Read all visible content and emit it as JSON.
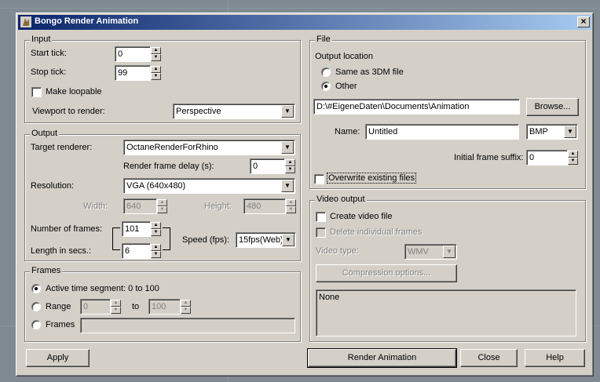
{
  "window": {
    "title": "Bongo Render Animation",
    "close_glyph": "×"
  },
  "input": {
    "legend": "Input",
    "start_tick_label": "Start tick:",
    "start_tick_value": "0",
    "stop_tick_label": "Stop tick:",
    "stop_tick_value": "99",
    "make_loopable_label": "Make loopable",
    "viewport_label": "Viewport to render:",
    "viewport_value": "Perspective"
  },
  "output": {
    "legend": "Output",
    "target_renderer_label": "Target renderer:",
    "target_renderer_value": "OctaneRenderForRhino",
    "render_delay_label": "Render frame delay (s):",
    "render_delay_value": "0",
    "resolution_label": "Resolution:",
    "resolution_value": "VGA (640x480)",
    "width_label": "Width:",
    "width_value": "640",
    "height_label": "Height:",
    "height_value": "480",
    "frames_label": "Number of frames:",
    "frames_value": "101",
    "length_label": "Length in secs.:",
    "length_value": "6",
    "speed_label": "Speed (fps):",
    "speed_value": "15fps(Web)"
  },
  "frames": {
    "legend": "Frames",
    "active_label": "Active time segment: 0 to 100",
    "range_label": "Range",
    "range_from": "0",
    "range_to_label": "to",
    "range_to": "100",
    "frames_label": "Frames",
    "frames_value": ""
  },
  "file": {
    "legend": "File",
    "output_location_label": "Output location",
    "same_as_label": "Same as 3DM file",
    "other_label": "Other",
    "path_value": "D:\\#EigeneDaten\\Documents\\Animation",
    "browse_label": "Browse...",
    "name_label": "Name:",
    "name_value": "Untitled",
    "format_value": "BMP",
    "initial_suffix_label": "Initial frame suffix:",
    "initial_suffix_value": "0",
    "overwrite_label": "Overwrite existing files"
  },
  "video": {
    "legend": "Video output",
    "create_label": "Create video file",
    "delete_label": "Delete individual frames",
    "type_label": "Video type:",
    "type_value": "WMV",
    "compression_label": "Compression options...",
    "codec_text": "None"
  },
  "buttons": {
    "apply": "Apply",
    "render": "Render Animation",
    "close": "Close",
    "help": "Help"
  },
  "icons": {
    "up": "▲",
    "down": "▼"
  }
}
